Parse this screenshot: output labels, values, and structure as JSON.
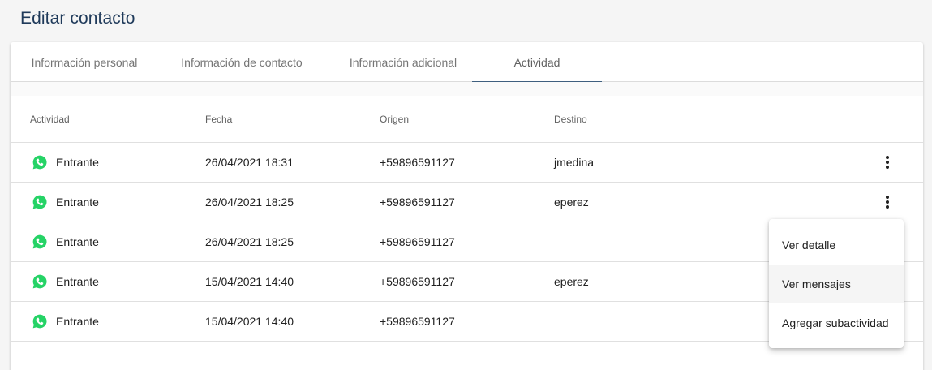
{
  "page": {
    "title": "Editar contacto"
  },
  "tabs": [
    {
      "label": "Información personal"
    },
    {
      "label": "Información de contacto"
    },
    {
      "label": "Información adicional"
    },
    {
      "label": "Actividad",
      "active": true
    }
  ],
  "table": {
    "columns": [
      "Actividad",
      "Fecha",
      "Origen",
      "Destino"
    ],
    "rows": [
      {
        "icon": "whatsapp-icon",
        "activity": "Entrante",
        "date": "26/04/2021 18:31",
        "origin": "+59896591127",
        "destination": "jmedina"
      },
      {
        "icon": "whatsapp-icon",
        "activity": "Entrante",
        "date": "26/04/2021 18:25",
        "origin": "+59896591127",
        "destination": "eperez"
      },
      {
        "icon": "whatsapp-icon",
        "activity": "Entrante",
        "date": "26/04/2021 18:25",
        "origin": "+59896591127",
        "destination": ""
      },
      {
        "icon": "whatsapp-icon",
        "activity": "Entrante",
        "date": "15/04/2021 14:40",
        "origin": "+59896591127",
        "destination": "eperez"
      },
      {
        "icon": "whatsapp-icon",
        "activity": "Entrante",
        "date": "15/04/2021 14:40",
        "origin": "+59896591127",
        "destination": ""
      }
    ]
  },
  "context_menu": {
    "items": [
      {
        "label": "Ver detalle"
      },
      {
        "label": "Ver mensajes"
      },
      {
        "label": "Agregar subactividad"
      }
    ]
  },
  "colors": {
    "title": "#1f3a5a",
    "tab_indicator": "#3f5f7f",
    "whatsapp": "#25d366",
    "background": "#f5f5f5"
  }
}
